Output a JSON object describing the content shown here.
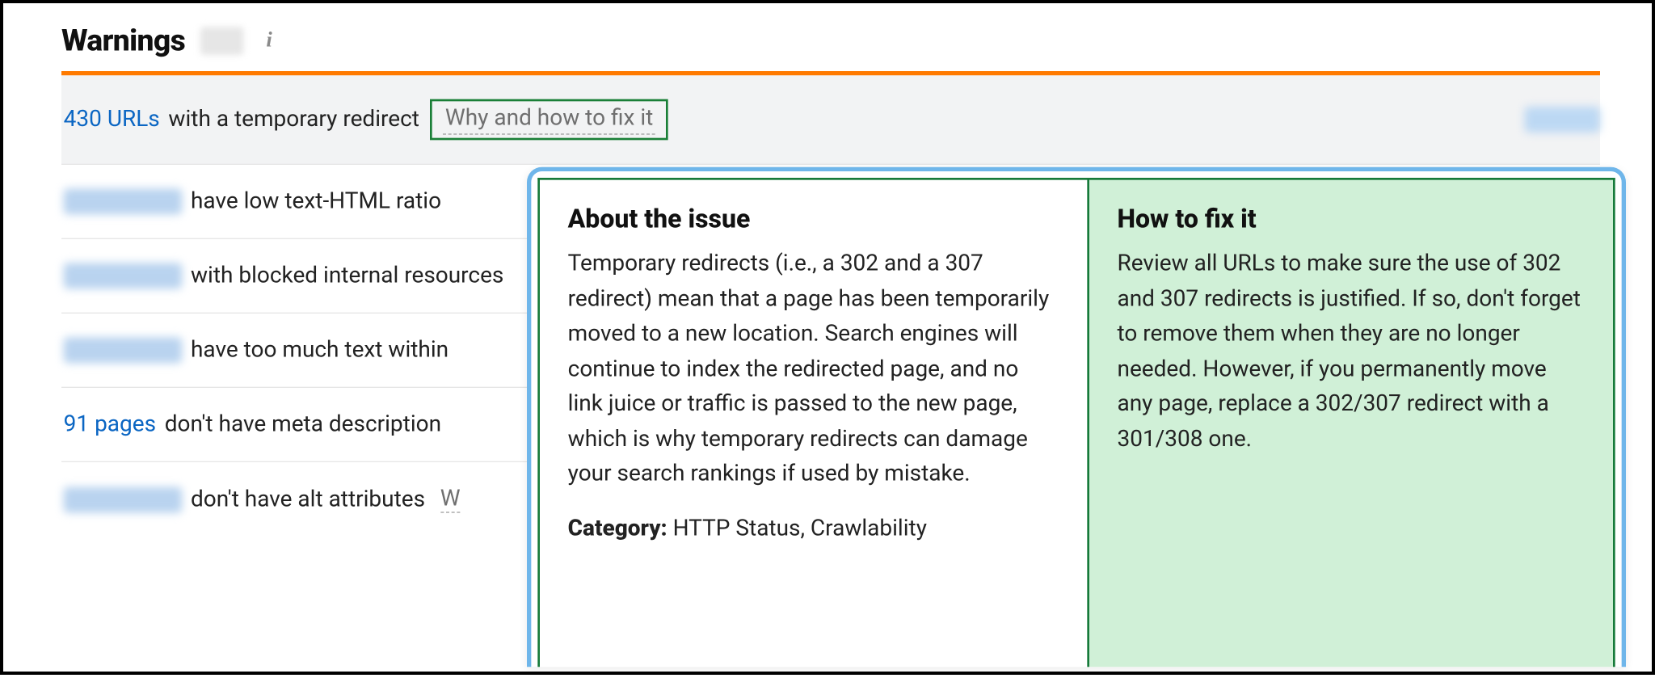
{
  "header": {
    "title": "Warnings",
    "info_icon": "i"
  },
  "issues": [
    {
      "count_text": "430 URLs",
      "count_visible": true,
      "desc": " with a temporary redirect",
      "hint": "Why and how to fix it",
      "hint_boxed": true,
      "selected": true
    },
    {
      "count_visible": false,
      "desc": " have low text-HTML ratio",
      "hint": "",
      "hint_boxed": false
    },
    {
      "count_visible": false,
      "desc": " with blocked internal resources",
      "hint": "",
      "hint_boxed": false
    },
    {
      "count_visible": false,
      "desc": " have too much text within",
      "hint": "",
      "hint_boxed": false
    },
    {
      "count_text": "91 pages",
      "count_visible": true,
      "desc": " don't have meta description",
      "hint": "",
      "hint_boxed": false
    },
    {
      "count_visible": false,
      "desc": " don't have alt attributes",
      "hint_fragment": "W",
      "hint_boxed": false
    }
  ],
  "popover": {
    "about_heading": "About the issue",
    "about_body": "Temporary redirects (i.e., a 302 and a 307 redirect) mean that a page has been temporarily moved to a new location. Search engines will continue to index the redirected page, and no link juice or traffic is passed to the new page, which is why temporary redirects can damage your search rankings if used by mistake.",
    "category_label": "Category:",
    "category_value": " HTTP Status, Crawlability",
    "fix_heading": "How to fix it",
    "fix_body": "Review all URLs to make sure the use of 302 and 307 redirects is justified. If so, don't forget to remove them when they are no longer needed. However, if you permanently move any page, replace a 302/307 redirect with a 301/308 one."
  }
}
